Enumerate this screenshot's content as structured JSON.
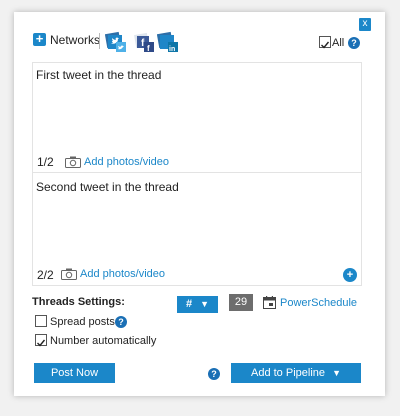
{
  "header": {
    "close_label": "x",
    "networks_label": "Networks",
    "all_label": "All",
    "all_checked": true,
    "help_glyph": "?",
    "network_icons": [
      "twitter-stack-icon",
      "facebook-stack-icon",
      "linkedin-stack-icon"
    ]
  },
  "tweets": [
    {
      "text": "First tweet in the thread",
      "counter": "1/2",
      "add_photos": "Add photos/video"
    },
    {
      "text": "Second tweet in the thread",
      "counter": "2/2",
      "add_photos": "Add photos/video"
    }
  ],
  "add_tweet_glyph": "+",
  "settings": {
    "title": "Threads Settings:",
    "hash_label": "#",
    "number_value": "29",
    "powerschedule_label": "PowerSchedule",
    "spread_posts_label": "Spread posts",
    "spread_posts_checked": false,
    "number_auto_label": "Number automatically",
    "number_auto_checked": true
  },
  "footer": {
    "post_now_label": "Post Now",
    "pipeline_label": "Add to Pipeline"
  },
  "colors": {
    "accent": "#1b87c9",
    "help": "#1a6fb5",
    "counter_box": "#6d6d6d",
    "background": "#f1f1f1"
  }
}
